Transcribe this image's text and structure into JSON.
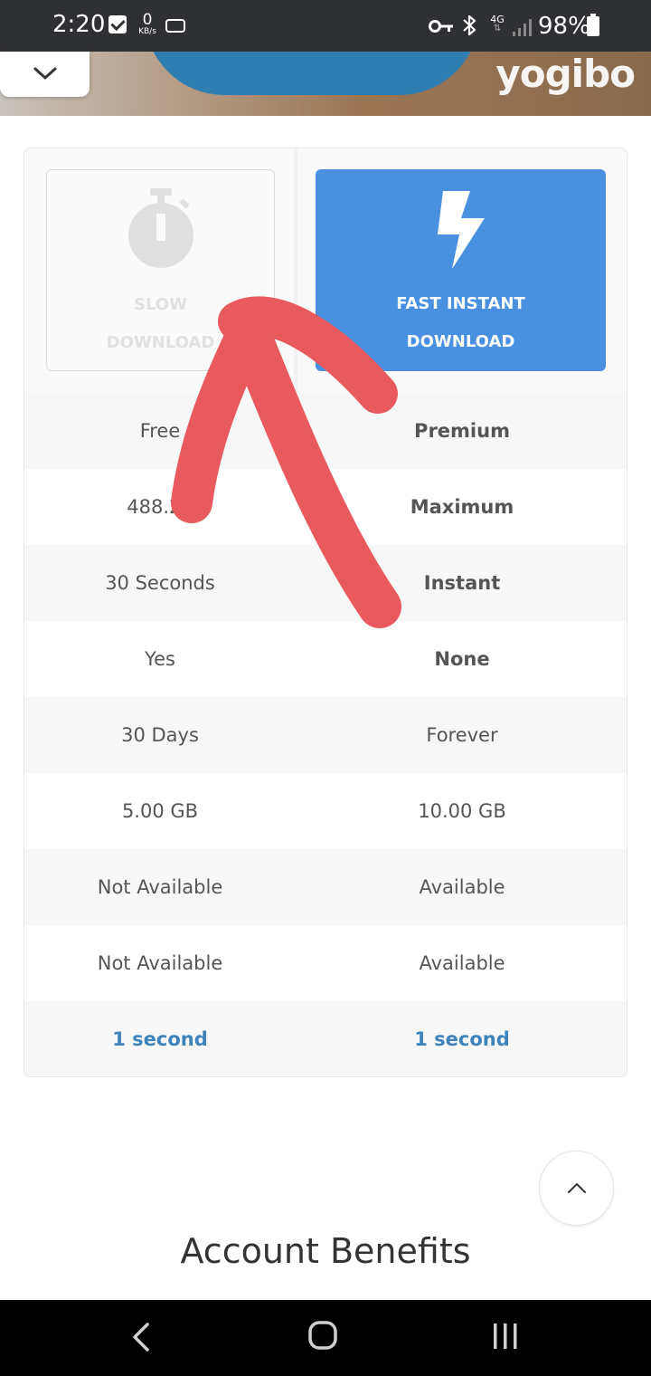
{
  "status_bar": {
    "time": "2:20",
    "speed_value": "0",
    "speed_unit": "KB/s",
    "network": "4G",
    "battery": "98%"
  },
  "banner": {
    "logo_text": "yogibo"
  },
  "download_options": {
    "slow": {
      "line1": "SLOW",
      "line2": "DOWNLOAD",
      "icon": "stopwatch-icon"
    },
    "fast": {
      "line1": "FAST INSTANT",
      "line2": "DOWNLOAD",
      "icon": "lightning-icon"
    }
  },
  "comparison_rows": [
    {
      "free": "Free",
      "premium": "Premium"
    },
    {
      "free": "488.28",
      "premium": "Maximum"
    },
    {
      "free": "30 Seconds",
      "premium": "Instant"
    },
    {
      "free": "Yes",
      "premium": "None"
    },
    {
      "free": "30 Days",
      "premium": "Forever"
    },
    {
      "free": "5.00 GB",
      "premium": "10.00 GB"
    },
    {
      "free": "Not Available",
      "premium": "Available"
    },
    {
      "free": "Not Available",
      "premium": "Available"
    },
    {
      "free": "1 second",
      "premium": "1 second"
    }
  ],
  "section_title": "Account Benefits",
  "colors": {
    "fast_button": "#4a90e0",
    "link_blue": "#3f83bd",
    "annotation_red": "#e85a5e"
  }
}
